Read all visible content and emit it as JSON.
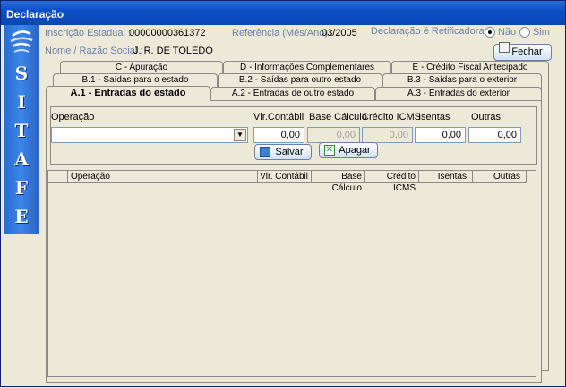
{
  "window": {
    "title": "Declaração"
  },
  "sidebar": {
    "letters": [
      "S",
      "I",
      "T",
      "A",
      "F",
      "E"
    ]
  },
  "header": {
    "inscricao_label": "Inscrição Estadual :",
    "inscricao_value": "00000000361372",
    "referencia_label": "Referência (Mês/Ano) :",
    "referencia_value": "03/2005",
    "retificadora_label": "Declaração é Retificadora ?",
    "opt_nao": "Não",
    "opt_sim": "Sim",
    "nome_label": "Nome / Razão Social :",
    "nome_value": "J. R. DE TOLEDO",
    "fechar_label": "Fechar"
  },
  "tabs": {
    "row1": [
      "C - Apuração",
      "D - Informações Complementares",
      "E - Crédito Fiscal Antecipado"
    ],
    "row2": [
      "B.1 - Saídas para o estado",
      "B.2 - Saídas para outro estado",
      "B.3 - Saídas para o exterior"
    ],
    "row3": [
      "A.1 - Entradas do estado",
      "A.2 - Entradas de outro estado",
      "A.3 - Entradas do exterior"
    ]
  },
  "form": {
    "operacao_label": "Operação",
    "vlr_label": "Vlr.Contábil",
    "base_label": "Base Cálculo",
    "credito_label": "Crédito ICMS",
    "isentas_label": "Isentas",
    "outras_label": "Outras",
    "vlr_value": "0,00",
    "base_value": "0,00",
    "credito_value": "0,00",
    "isentas_value": "0,00",
    "outras_value": "0,00",
    "salvar_label": "Salvar",
    "apagar_label": "Apagar"
  },
  "grid": {
    "columns": [
      "Operação",
      "Vlr. Contábil",
      "Base Cálculo",
      "Crédito ICMS",
      "Isentas",
      "Outras"
    ]
  }
}
